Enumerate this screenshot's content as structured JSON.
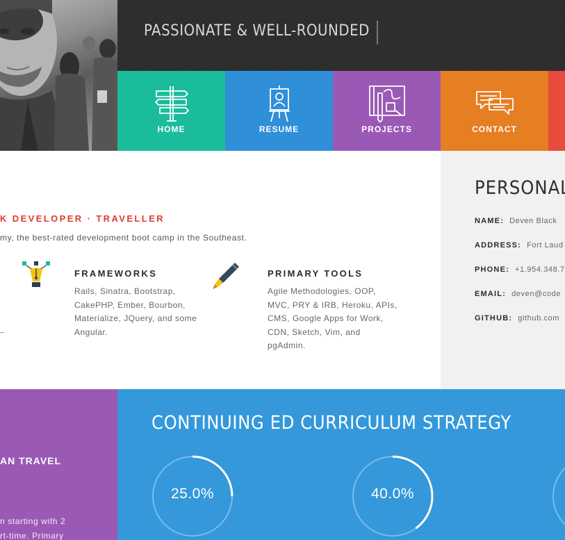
{
  "header": {
    "tagline": "PASSIONATE & WELL-ROUNDED"
  },
  "nav": [
    {
      "label": "HOME",
      "icon": "signpost-icon",
      "color": "#1abc9c"
    },
    {
      "label": "RESUME",
      "icon": "easel-icon",
      "color": "#2f8fd8"
    },
    {
      "label": "PROJECTS",
      "icon": "blueprint-icon",
      "color": "#9b59b6"
    },
    {
      "label": "CONTACT",
      "icon": "chat-bubbles-icon",
      "color": "#e67e22"
    },
    {
      "label": "",
      "icon": "",
      "color": "#e74c3c"
    }
  ],
  "skills": {
    "title": "K DEVELOPER · TRAVELLER",
    "subtitle": "my, the best-rated development boot camp in the Southeast.",
    "frameworks": {
      "heading": "FRAMEWORKS",
      "icon": "vector-pen-icon",
      "lines": [
        "Rails, Sinatra, Bootstrap,",
        "CakePHP, Ember, Bourbon,",
        "Materialize, JQuery, and some",
        "Angular."
      ]
    },
    "tools": {
      "heading": "PRIMARY TOOLS",
      "icon": "fountain-pen-icon",
      "lines": [
        "Agile Methodologies, OOP,",
        "MVC, PRY & IRB, Heroku, APIs,",
        "CMS, Google Apps for Work,",
        "CDN, Sketch, Vim, and",
        "pgAdmin."
      ]
    }
  },
  "personal": {
    "title": "PERSONAL",
    "rows": [
      {
        "key": "NAME:",
        "value": "Deven Black"
      },
      {
        "key": "ADDRESS:",
        "value": "Fort Laud"
      },
      {
        "key": "PHONE:",
        "value": "+1.954.348.7"
      },
      {
        "key": "EMAIL:",
        "value": "deven@code"
      },
      {
        "key": "GITHUB:",
        "value": "github.com"
      }
    ]
  },
  "travel": {
    "heading": "AN TRAVEL",
    "text": "n starting with 2\nrt-time. Primary"
  },
  "curriculum": {
    "title": "CONTINUING ED CURRICULUM STRATEGY",
    "gauges": [
      {
        "label": "25.0%",
        "value": 25.0
      },
      {
        "label": "40.0%",
        "value": 40.0
      },
      {
        "label": "",
        "value": 0
      }
    ]
  },
  "colors": {
    "accent_red": "#e03b2c",
    "teal": "#1abc9c",
    "blue": "#3498db",
    "purple": "#9b59b6",
    "orange": "#e67e22"
  }
}
